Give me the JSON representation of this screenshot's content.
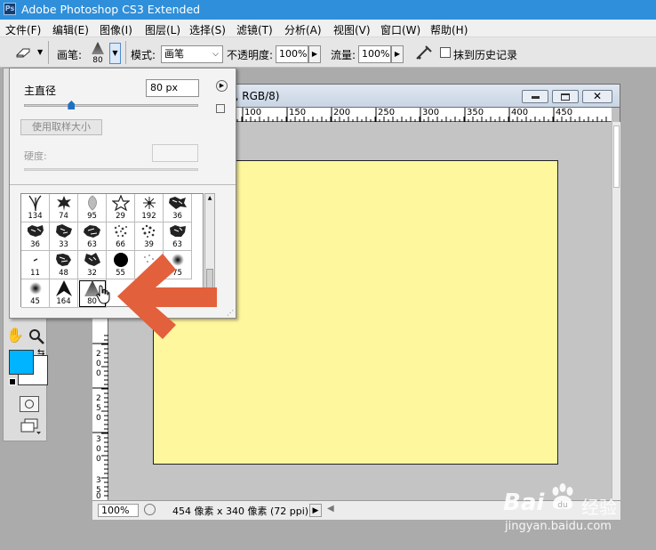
{
  "window": {
    "title": "Adobe Photoshop CS3 Extended",
    "app_icon": "Ps"
  },
  "menu": [
    "文件(F)",
    "编辑(E)",
    "图像(I)",
    "图层(L)",
    "选择(S)",
    "滤镜(T)",
    "分析(A)",
    "视图(V)",
    "窗口(W)",
    "帮助(H)"
  ],
  "options": {
    "brush_label": "画笔:",
    "brush_size": "80",
    "mode_label": "模式:",
    "mode_value": "画笔",
    "opacity_label": "不透明度:",
    "opacity_value": "100%",
    "flow_label": "流量:",
    "flow_value": "100%",
    "history_label": "抹到历史记录"
  },
  "brush_panel": {
    "diameter_label": "主直径",
    "diameter_value": "80 px",
    "sample_button": "使用取样大小",
    "hardness_label": "硬度:",
    "diameter_fraction": 0.27,
    "presets": [
      "134",
      "74",
      "95",
      "29",
      "192",
      "36",
      "36",
      "33",
      "63",
      "66",
      "39",
      "63",
      "11",
      "48",
      "32",
      "55",
      "",
      "75",
      "45",
      "164",
      "80"
    ]
  },
  "document": {
    "title_fragment": "1, RGB/8)",
    "ruler_top": [
      "100",
      "150",
      "200",
      "250",
      "300",
      "350",
      "400",
      "450"
    ],
    "ruler_left": [
      "2",
      "0",
      "0",
      "2",
      "5",
      "0",
      "3",
      "0",
      "0",
      "3",
      "5",
      "0"
    ],
    "zoom": "100%",
    "status_info": "454 像素 x 340 像素 (72 ppi)"
  },
  "watermark": {
    "brand": "Bai",
    "brand2": "经验",
    "url": "jingyan.baidu.com"
  },
  "colors": {
    "titlebar": "#2f8fda",
    "canvas": "#fff79e",
    "foreground": "#00b4ff",
    "arrow": "#e2603c"
  }
}
